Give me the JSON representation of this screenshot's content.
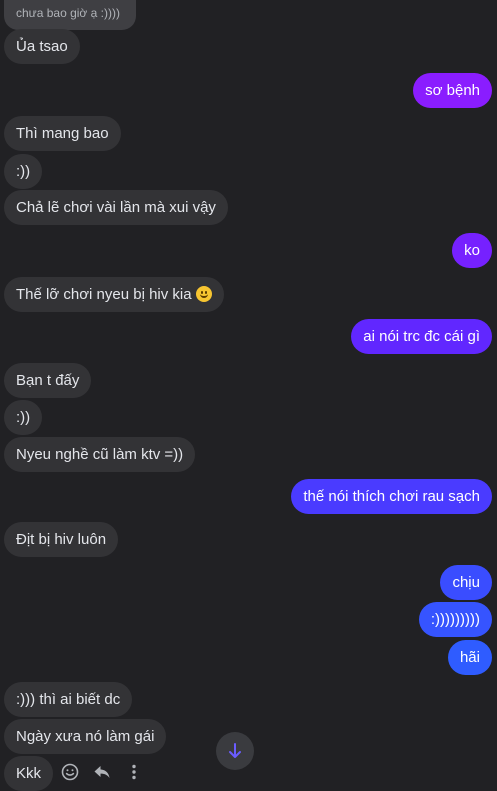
{
  "reply_quote": "chưa bao giờ ạ :))))",
  "messages": [
    {
      "text": "Ủa tsao",
      "dir": "in"
    },
    {
      "text": "sơ bệnh",
      "dir": "out"
    },
    {
      "text": "Thì mang bao",
      "dir": "in"
    },
    {
      "text": ":))",
      "dir": "in"
    },
    {
      "text": "Chả lẽ chơi vài lần mà xui vậy",
      "dir": "in"
    },
    {
      "text": "ko",
      "dir": "out"
    },
    {
      "text": "Thế lỡ chơi nyeu bị hiv kia",
      "dir": "in"
    },
    {
      "text": "ai nói trc đc cái gì",
      "dir": "out"
    },
    {
      "text": "Bạn t đấy",
      "dir": "in"
    },
    {
      "text": ":))",
      "dir": "in"
    },
    {
      "text": "Nyeu nghề cũ làm ktv =))",
      "dir": "in"
    },
    {
      "text": "thế nói thích chơi rau sạch",
      "dir": "out"
    },
    {
      "text": "Địt bị hiv luôn",
      "dir": "in"
    },
    {
      "text": "chịu",
      "dir": "out"
    },
    {
      "text": ":)))))))))",
      "dir": "out"
    },
    {
      "text": "hãi",
      "dir": "out"
    },
    {
      "text": ":))) thì ai biết dc",
      "dir": "in"
    },
    {
      "text": "Ngày xưa nó làm gái",
      "dir": "in"
    },
    {
      "text": "Kkk",
      "dir": "in"
    }
  ],
  "colors": {
    "background": "#212124",
    "incoming": "#333336",
    "outgoing_purple": "#8a1dff",
    "outgoing_violet": "#6b2bff",
    "outgoing_blue": "#3b4cff",
    "outgoing_bright_blue": "#2f5cff"
  },
  "icons": {
    "react": "smiley-icon",
    "reply": "reply-icon",
    "more": "more-vertical-icon",
    "scroll": "arrow-down-icon"
  }
}
